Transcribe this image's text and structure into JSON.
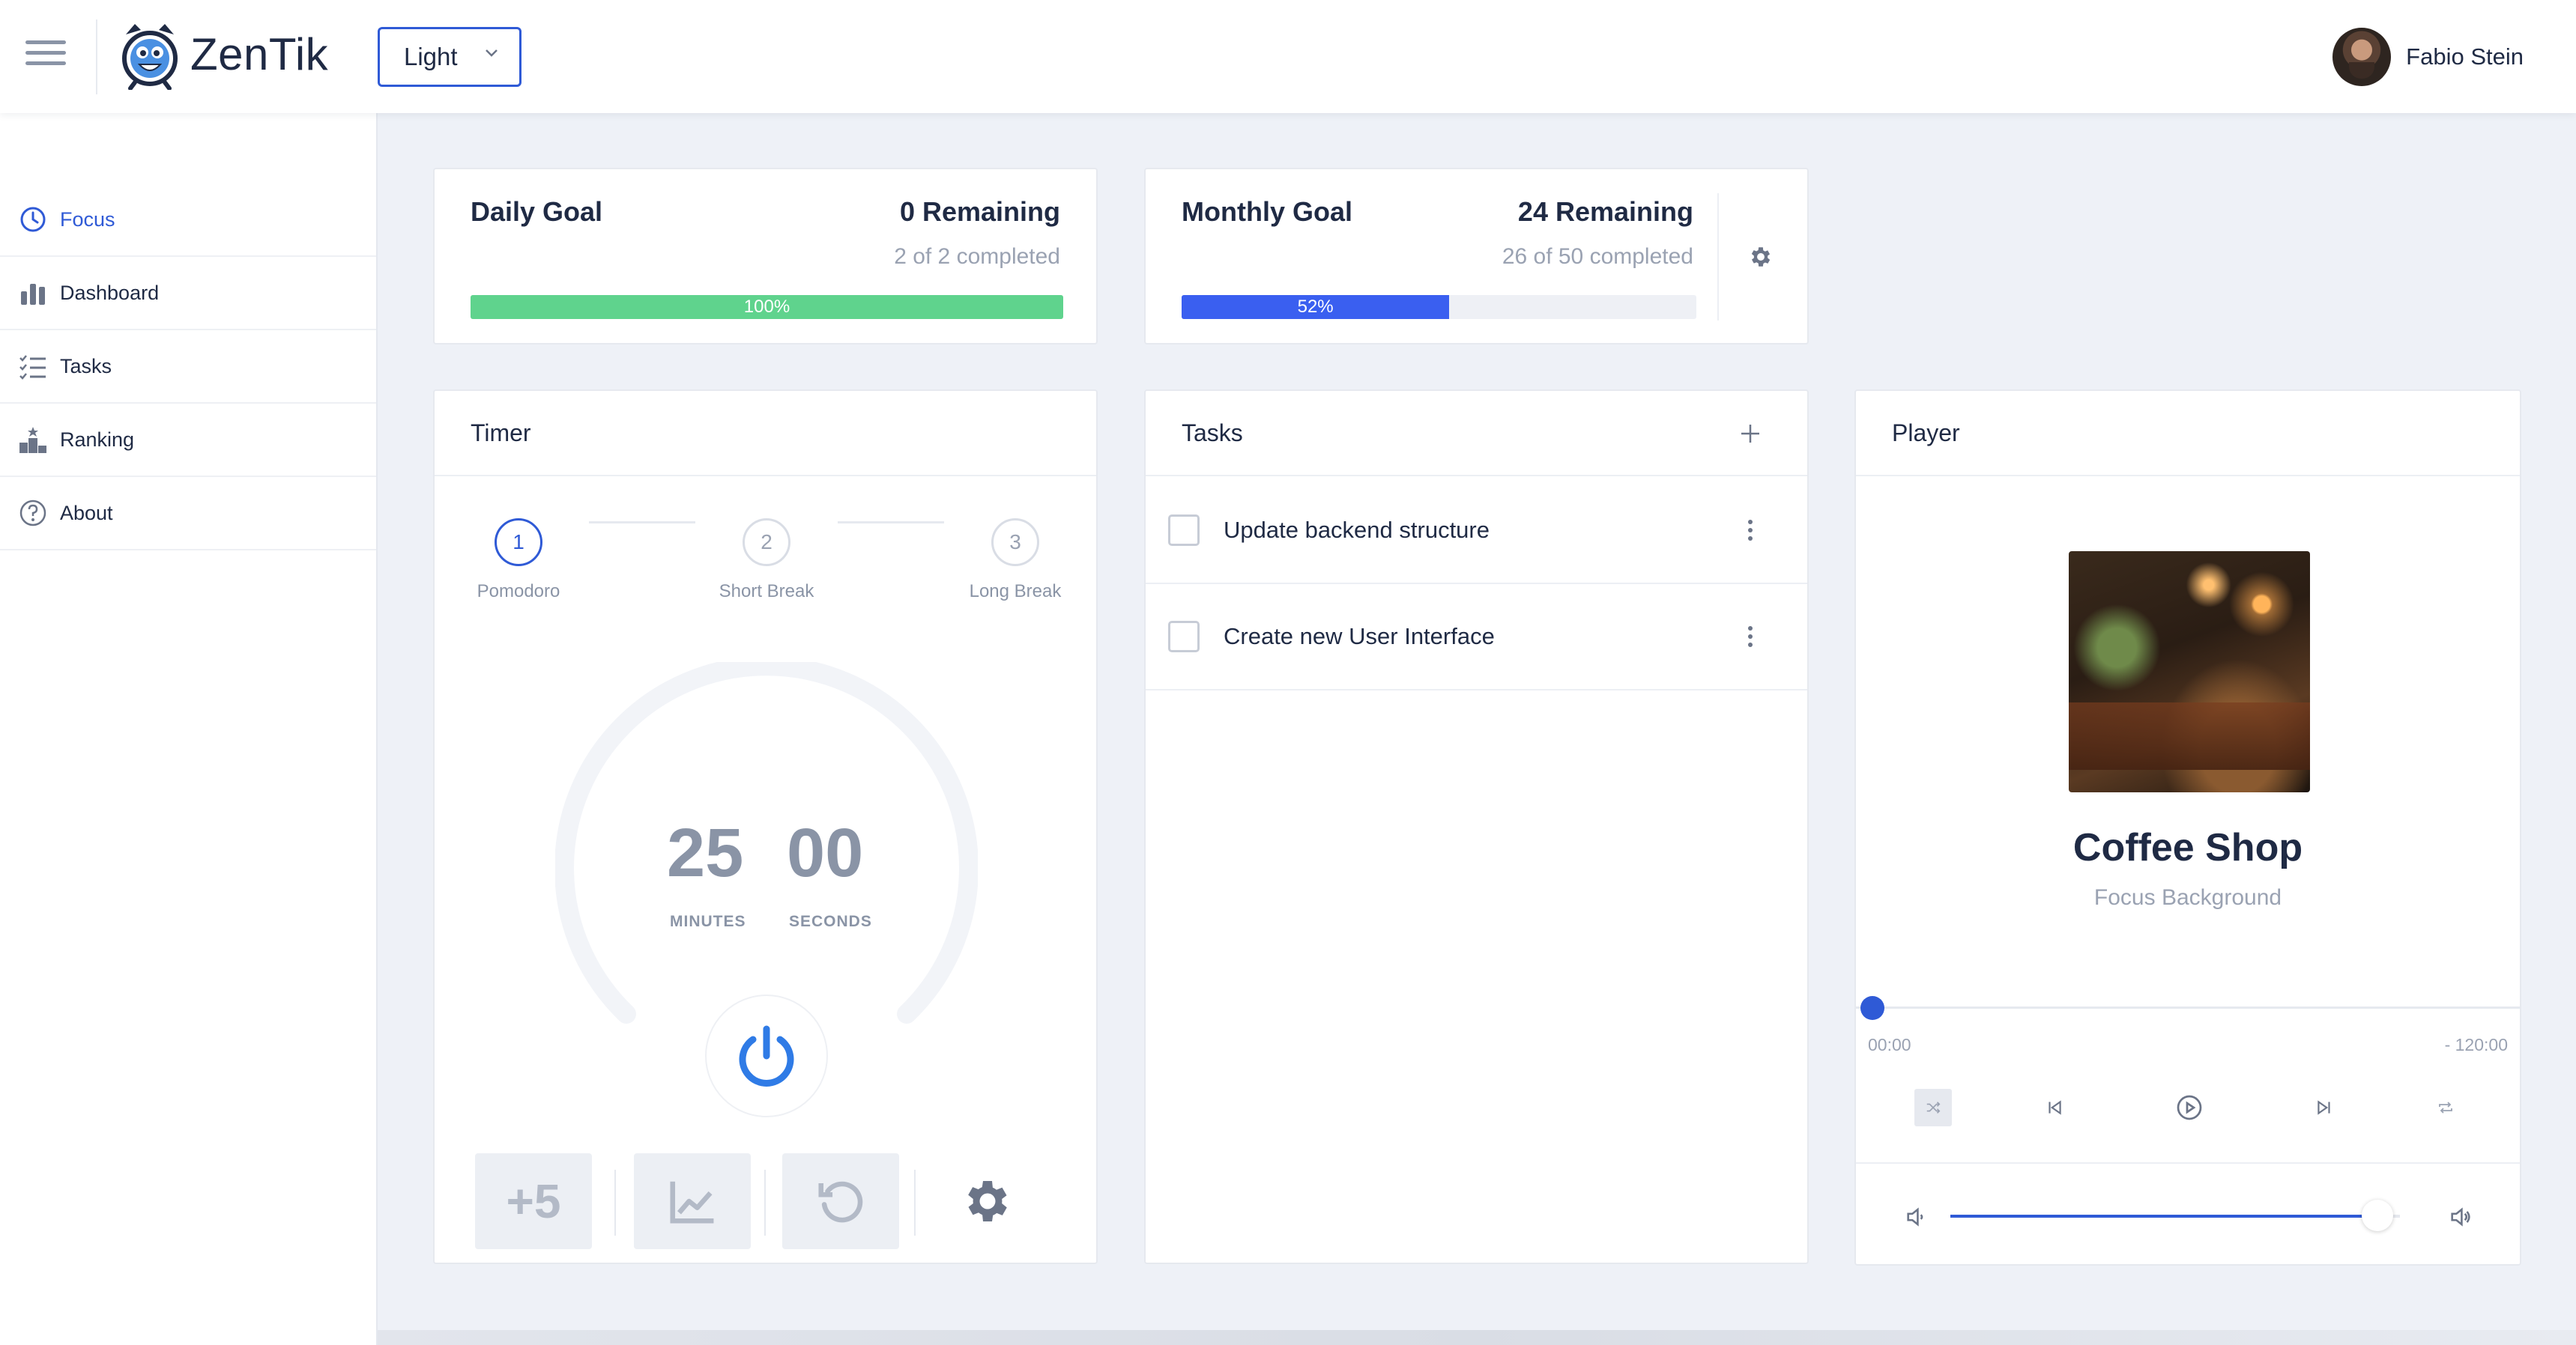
{
  "app": {
    "brand": "ZenTik",
    "theme_select": "Light"
  },
  "user": {
    "name": "Fabio Stein"
  },
  "sidebar": {
    "items": [
      {
        "label": "Focus",
        "icon": "clock-icon",
        "active": true
      },
      {
        "label": "Dashboard",
        "icon": "bar-chart-icon"
      },
      {
        "label": "Tasks",
        "icon": "checklist-icon"
      },
      {
        "label": "Ranking",
        "icon": "podium-icon"
      },
      {
        "label": "About",
        "icon": "help-circle-icon"
      }
    ]
  },
  "daily_goal": {
    "title": "Daily Goal",
    "remaining": "0 Remaining",
    "completed": "2 of 2 completed",
    "progress_percent": 100,
    "progress_label": "100%",
    "color": "#5fd38d"
  },
  "monthly_goal": {
    "title": "Monthly Goal",
    "remaining": "24 Remaining",
    "completed": "26 of 50 completed",
    "progress_percent": 52,
    "progress_label": "52%",
    "color": "#3a5ff0"
  },
  "timer": {
    "title": "Timer",
    "steps": [
      {
        "num": "1",
        "label": "Pomodoro",
        "active": true
      },
      {
        "num": "2",
        "label": "Short Break"
      },
      {
        "num": "3",
        "label": "Long Break"
      }
    ],
    "minutes": "25",
    "seconds": "00",
    "minutes_label": "MINUTES",
    "seconds_label": "SECONDS",
    "add_label": "+5"
  },
  "tasks": {
    "title": "Tasks",
    "items": [
      {
        "text": "Update backend structure",
        "done": false
      },
      {
        "text": "Create new User Interface",
        "done": false
      }
    ]
  },
  "player": {
    "title": "Player",
    "track": "Coffee Shop",
    "subtitle": "Focus Background",
    "time_elapsed": "00:00",
    "time_remaining": "- 120:00",
    "progress_fraction": 0,
    "volume_fraction": 0.95
  },
  "colors": {
    "accent": "#2f5ad6",
    "background": "#eef1f7"
  }
}
